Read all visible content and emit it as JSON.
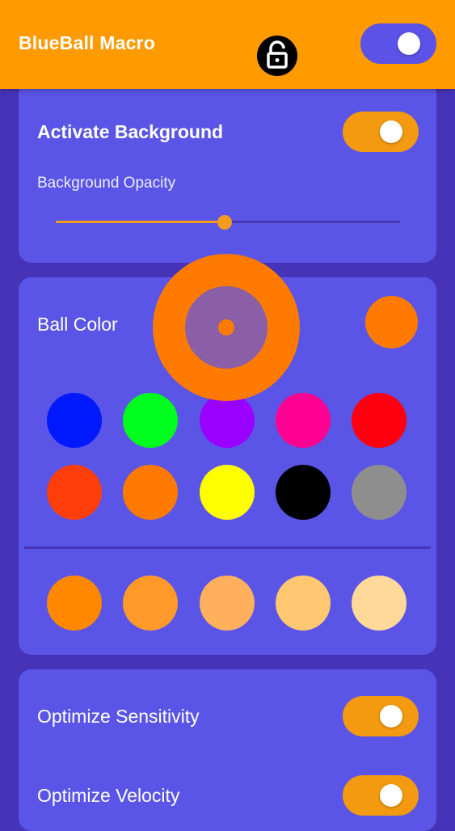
{
  "app": {
    "title": "BlueBall Macro",
    "lock_icon": "unlocked-padlock-icon",
    "master_toggle_on": true
  },
  "background_card": {
    "title": "Activate Background",
    "toggle_on": true,
    "opacity_label": "Background Opacity",
    "opacity_value": 0.49
  },
  "color_card": {
    "title": "Ball Color",
    "selected_color": "#ff7a00",
    "palette": [
      "#0019ff",
      "#00ff1e",
      "#9900ff",
      "#ff0093",
      "#ff0010",
      "#ff3e0a",
      "#ff7a00",
      "#ffff00",
      "#000000",
      "#8e8e8e"
    ],
    "shades": [
      "#ff8800",
      "#ff9a2a",
      "#ffb05c",
      "#ffc870",
      "#ffd999"
    ]
  },
  "options_card": {
    "sensitivity_label": "Optimize Sensitivity",
    "sensitivity_on": true,
    "velocity_label": "Optimize Velocity",
    "velocity_on": true
  },
  "colors": {
    "accent": "#ff9a00",
    "background": "#4733b8",
    "card": "#5a55e6"
  }
}
